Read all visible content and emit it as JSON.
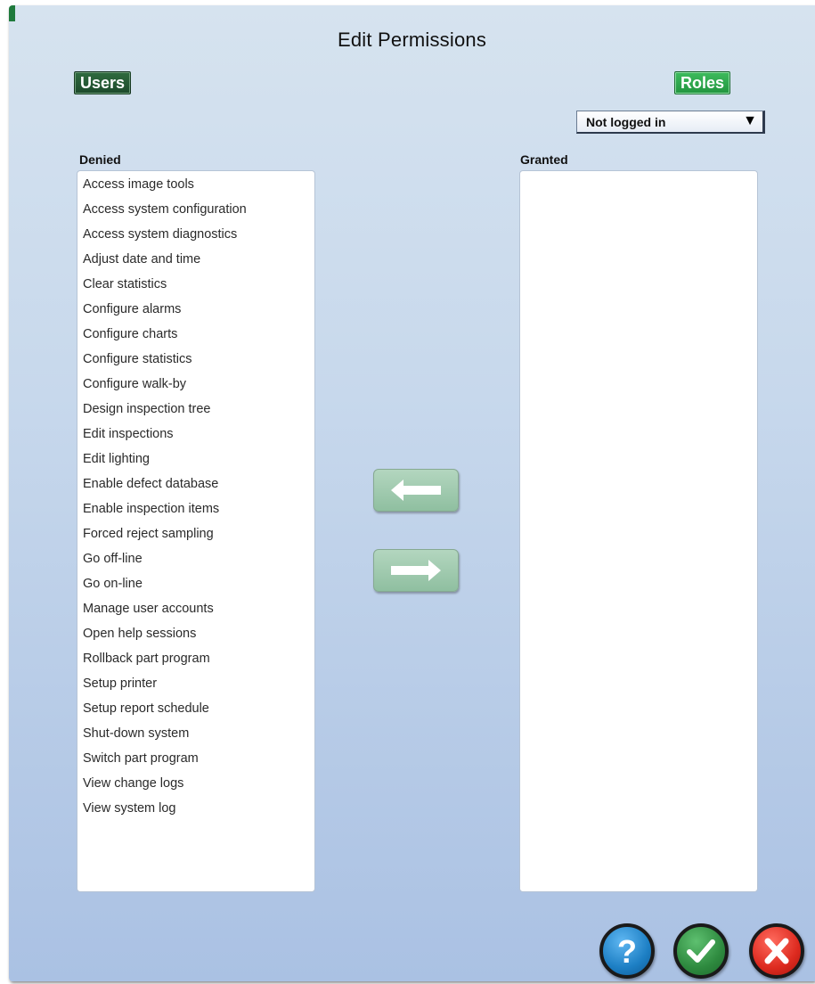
{
  "dialog": {
    "title": "Edit Permissions"
  },
  "tabs": {
    "users_label": "Users",
    "roles_label": "Roles"
  },
  "role_select": {
    "selected": "Not logged in"
  },
  "denied": {
    "label": "Denied",
    "items": [
      "Access image tools",
      "Access system configuration",
      "Access system diagnostics",
      "Adjust date and time",
      "Clear statistics",
      "Configure alarms",
      "Configure charts",
      "Configure statistics",
      "Configure walk-by",
      "Design inspection tree",
      "Edit inspections",
      "Edit lighting",
      "Enable defect database",
      "Enable inspection items",
      "Forced reject sampling",
      "Go off-line",
      "Go on-line",
      "Manage user accounts",
      "Open help sessions",
      "Rollback part program",
      "Setup printer",
      "Setup report schedule",
      "Shut-down system",
      "Switch part program",
      "View change logs",
      "View system log"
    ]
  },
  "granted": {
    "label": "Granted",
    "items": []
  },
  "icons": {
    "move_left": "arrow-left-icon",
    "move_right": "arrow-right-icon",
    "help": "question-mark-icon",
    "ok": "checkmark-icon",
    "cancel": "x-icon"
  },
  "colors": {
    "users_tab": "#1d4a2b",
    "roles_tab": "#22953f",
    "help": "#1d7fc4",
    "ok": "#2e8a3f",
    "cancel": "#dd2a1f"
  }
}
